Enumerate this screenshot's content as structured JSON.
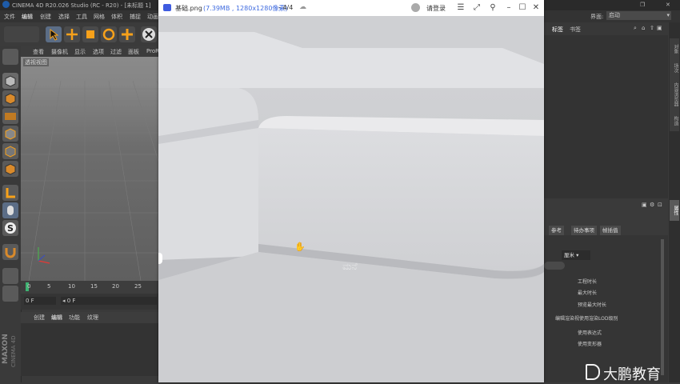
{
  "app_title": "CINEMA 4D R20.026 Studio (RC - R20) - [未标题 1]",
  "window_controls": {
    "restore": "❐",
    "close": "✕"
  },
  "menubar": {
    "items": [
      "文件",
      "编辑",
      "创建",
      "选择",
      "工具",
      "网格",
      "体积",
      "捕捉",
      "动画"
    ],
    "interface_label": "界面:",
    "interface_value": "启动"
  },
  "viewport": {
    "menu": [
      "查看",
      "摄像机",
      "显示",
      "选项",
      "过滤",
      "面板",
      "ProR"
    ],
    "label": "透视视图"
  },
  "timeline": {
    "ticks": [
      "0",
      "5",
      "10",
      "15",
      "20",
      "25"
    ],
    "frame_field": "0 F",
    "frame_field2": "0 F"
  },
  "materials": {
    "menu": [
      "创建",
      "编辑",
      "功能",
      "纹理"
    ]
  },
  "maxon_logo": {
    "brand": "MAXON",
    "product": "CINEMA 4D"
  },
  "right_panel": {
    "top_tabs": [
      "标签",
      "书签"
    ],
    "side_tabs": [
      "对象",
      "场次",
      "内容浏览器",
      "构造"
    ],
    "attr_side_tab": "属性",
    "attr_tabs": [
      "参考",
      "待办事项",
      "帧插值"
    ],
    "unit_value": "厘米",
    "attr_rows": [
      "工程时长",
      "最大时长",
      "预览最大时长",
      "编辑渲染视使用渲染LOD级别",
      "使用表达式",
      "使用变形器"
    ]
  },
  "viewer": {
    "file_name": "基础.png",
    "file_info": "(7.39MB , 1280x1280像素)",
    "page": "- 4/4",
    "login": "请登录",
    "image_watermark": "ಮನೆ"
  },
  "watermark": {
    "text": "大鹏教育"
  },
  "colors": {
    "c4d_bg": "#3a3a3a",
    "viewer_bg": "#c9cacd",
    "accent": "#5b6d86"
  }
}
